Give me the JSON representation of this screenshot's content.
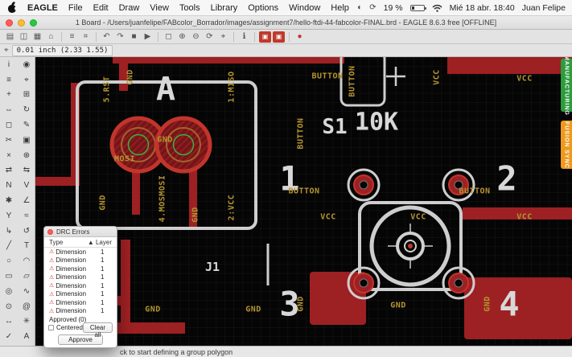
{
  "colors": {
    "copper": "#9d2023",
    "copper_bright": "#c1352b",
    "silkscreen": "#cecece",
    "label_yellow": "#b49530",
    "canvas_bg": "#050505",
    "grid": "#151515",
    "manufacturing_green": "#2e9b3e",
    "fusion_orange": "#ef9a1d",
    "drill_green": "#3fae3f"
  },
  "menu_bar": {
    "app": "EAGLE",
    "items": [
      "File",
      "Edit",
      "Draw",
      "View",
      "Tools",
      "Library",
      "Options",
      "Window",
      "Help"
    ],
    "battery": "19 %",
    "clock": "Mié 18 abr. 18:40",
    "user": "Juan Felipe"
  },
  "window": {
    "title": "1 Board - /Users/juanfelipe/FABcolor_Borrador/images/assignment7/hello-ftdi-44-fabcolor-FINAL.brd - EAGLE 8.6.3 free [OFFLINE]"
  },
  "toolbar": {
    "icons": [
      {
        "name": "open",
        "glyph": "▤"
      },
      {
        "name": "save",
        "glyph": "◫"
      },
      {
        "name": "print",
        "glyph": "▦"
      },
      {
        "name": "cam-processor",
        "glyph": "⌂"
      },
      {
        "name": "layer-settings",
        "glyph": "≡"
      },
      {
        "name": "grid",
        "glyph": "⌗"
      },
      {
        "name": "undo",
        "glyph": "↶"
      },
      {
        "name": "redo",
        "glyph": "↷"
      },
      {
        "name": "stop",
        "glyph": "■"
      },
      {
        "name": "go",
        "glyph": "▶"
      },
      {
        "name": "zoom-fit",
        "glyph": "◻"
      },
      {
        "name": "zoom-in",
        "glyph": "⊕"
      },
      {
        "name": "zoom-out",
        "glyph": "⊖"
      },
      {
        "name": "zoom-redraw",
        "glyph": "⟳"
      },
      {
        "name": "zoom-select",
        "glyph": "⌖"
      },
      {
        "name": "info",
        "glyph": "ℹ"
      },
      {
        "name": "drc",
        "glyph": "▣",
        "variant": "red"
      },
      {
        "name": "errors",
        "glyph": "▣",
        "variant": "red"
      },
      {
        "name": "record",
        "glyph": "●",
        "variant": "red-dot"
      }
    ]
  },
  "coord_bar": {
    "icon_glyph": "⌖",
    "coords": "0.01 inch (2.33 1.55)"
  },
  "palette": {
    "tools": [
      {
        "name": "info",
        "glyph": "i"
      },
      {
        "name": "show",
        "glyph": "◉"
      },
      {
        "name": "display",
        "glyph": "≡"
      },
      {
        "name": "mark",
        "glyph": "⌖"
      },
      {
        "name": "move",
        "glyph": "+"
      },
      {
        "name": "copy",
        "glyph": "⊞"
      },
      {
        "name": "mirror",
        "glyph": "⇔"
      },
      {
        "name": "rotate",
        "glyph": "↻"
      },
      {
        "name": "group",
        "glyph": "◻"
      },
      {
        "name": "change",
        "glyph": "✎"
      },
      {
        "name": "cut",
        "glyph": "✂"
      },
      {
        "name": "paste",
        "glyph": "▣"
      },
      {
        "name": "delete",
        "glyph": "×"
      },
      {
        "name": "add",
        "glyph": "⊕"
      },
      {
        "name": "pinswap",
        "glyph": "⇄"
      },
      {
        "name": "replace",
        "glyph": "⇆"
      },
      {
        "name": "name",
        "glyph": "N"
      },
      {
        "name": "value",
        "glyph": "V"
      },
      {
        "name": "smash",
        "glyph": "✱"
      },
      {
        "name": "miter",
        "glyph": "∠"
      },
      {
        "name": "split",
        "glyph": "Y"
      },
      {
        "name": "optimize",
        "glyph": "≈"
      },
      {
        "name": "route",
        "glyph": "↳"
      },
      {
        "name": "ripup",
        "glyph": "↺"
      },
      {
        "name": "wire",
        "glyph": "╱"
      },
      {
        "name": "text",
        "glyph": "T"
      },
      {
        "name": "circle",
        "glyph": "○"
      },
      {
        "name": "arc",
        "glyph": "◠"
      },
      {
        "name": "rect",
        "glyph": "▭"
      },
      {
        "name": "polygon",
        "glyph": "▱"
      },
      {
        "name": "via",
        "glyph": "◎"
      },
      {
        "name": "signal",
        "glyph": "∿"
      },
      {
        "name": "hole",
        "glyph": "⊙"
      },
      {
        "name": "attribute",
        "glyph": "@"
      },
      {
        "name": "dimension",
        "glyph": "↔"
      },
      {
        "name": "ratsnest",
        "glyph": "✳"
      },
      {
        "name": "errors",
        "glyph": "✓"
      },
      {
        "name": "autoroute",
        "glyph": "A"
      }
    ]
  },
  "canvas": {
    "labels": [
      {
        "text": "5.RST"
      },
      {
        "text": "GND"
      },
      {
        "text": "A"
      },
      {
        "text": "1:MISO"
      },
      {
        "text": "BUTTON"
      },
      {
        "text": "BUTTON"
      },
      {
        "text": "VCC"
      },
      {
        "text": "VCC"
      },
      {
        "text": "S1"
      },
      {
        "text": "10K"
      },
      {
        "text": "BUTTON"
      },
      {
        "text": "GND"
      },
      {
        "text": "MOSI"
      },
      {
        "text": "GND"
      },
      {
        "text": "4.MOSMOSI"
      },
      {
        "text": "GND"
      },
      {
        "text": "2:VCC"
      },
      {
        "text": "1"
      },
      {
        "text": "BUTTON"
      },
      {
        "text": "2"
      },
      {
        "text": "BUTTON"
      },
      {
        "text": "VCC"
      },
      {
        "text": "VCC"
      },
      {
        "text": "VCC"
      },
      {
        "text": "J1"
      },
      {
        "text": "GND"
      },
      {
        "text": "GND"
      },
      {
        "text": "3"
      },
      {
        "text": "GND"
      },
      {
        "text": "GND"
      },
      {
        "text": "4"
      },
      {
        "text": "GND"
      }
    ]
  },
  "side_tabs": {
    "manufacturing": "MANUFACTURING",
    "fusion_sync": "FUSION SYNC"
  },
  "drc_dialog": {
    "title": "DRC Errors",
    "col_type": "Type",
    "col_layer": "Layer",
    "sort_icon": "▲",
    "warn_icon": "⚠",
    "rows": [
      {
        "type": "Dimension",
        "layer": "1"
      },
      {
        "type": "Dimension",
        "layer": "1"
      },
      {
        "type": "Dimension",
        "layer": "1"
      },
      {
        "type": "Dimension",
        "layer": "1"
      },
      {
        "type": "Dimension",
        "layer": "1"
      },
      {
        "type": "Dimension",
        "layer": "1"
      },
      {
        "type": "Dimension",
        "layer": "1"
      },
      {
        "type": "Dimension",
        "layer": "1"
      }
    ],
    "approved": "Approved (0)",
    "centered": "Centered",
    "clear_all": "Clear all",
    "approve": "Approve"
  },
  "status_bar": {
    "message": "ck to start defining a group polygon"
  }
}
